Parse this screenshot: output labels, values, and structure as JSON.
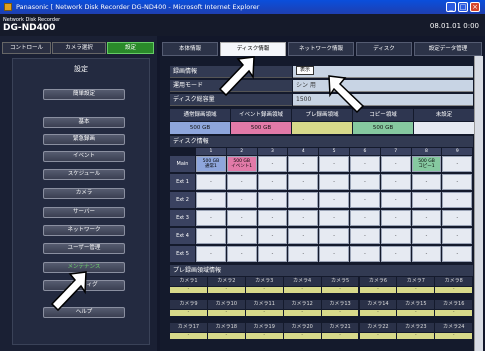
{
  "window": {
    "title": "Panasonic [ Network Disk Recorder DG-ND400 - Microsoft Internet Explorer",
    "minimize": "_",
    "maximize": "□",
    "close": "×"
  },
  "header": {
    "subtitle": "Network Disk Recorder",
    "model": "DG-ND400",
    "clock": "08.01.01 0:00"
  },
  "top_tabs": [
    "コントロール",
    "カメラ選択",
    "設定"
  ],
  "left": {
    "title": "設定",
    "buttons": [
      "簡単設定",
      "基本",
      "緊急録画",
      "イベント",
      "スケジュール",
      "カメラ",
      "サーバー",
      "ネットワーク",
      "ユーザー管理",
      "メンテナンス",
      "コンフィグ",
      "ヘルプ"
    ]
  },
  "right_tabs": [
    "本体情報",
    "ディスク情報",
    "ネットワーク情報",
    "ディスク",
    "設定データ管理"
  ],
  "info": {
    "rows": [
      {
        "label": "録画情報",
        "value": ""
      },
      {
        "label": "運用モード",
        "value": "シン 用"
      },
      {
        "label": "ディスク総容量",
        "value": "1500"
      }
    ],
    "display_button": "表示"
  },
  "capacity": {
    "headers": [
      "通常録画領域",
      "イベント録画領域",
      "プレ録画領域",
      "コピー領域",
      "未設定"
    ],
    "values": [
      "500 GB",
      "500 GB",
      "",
      "500 GB",
      ""
    ]
  },
  "disk_info": {
    "title": "ディスク情報",
    "columns": [
      "1",
      "2",
      "3",
      "4",
      "5",
      "6",
      "7",
      "8",
      "9"
    ],
    "rows": [
      {
        "label": "Main",
        "cells": [
          "500 GB\n通常1",
          "500 GB\nイベント1",
          "-",
          "-",
          "-",
          "-",
          "-",
          "500 GB\nコピー1",
          "-"
        ]
      },
      {
        "label": "Ext 1",
        "cells": [
          "-",
          "-",
          "-",
          "-",
          "-",
          "-",
          "-",
          "-",
          "-"
        ]
      },
      {
        "label": "Ext 2",
        "cells": [
          "-",
          "-",
          "-",
          "-",
          "-",
          "-",
          "-",
          "-",
          "-"
        ]
      },
      {
        "label": "Ext 3",
        "cells": [
          "-",
          "-",
          "-",
          "-",
          "-",
          "-",
          "-",
          "-",
          "-"
        ]
      },
      {
        "label": "Ext 4",
        "cells": [
          "-",
          "-",
          "-",
          "-",
          "-",
          "-",
          "-",
          "-",
          "-"
        ]
      },
      {
        "label": "Ext 5",
        "cells": [
          "-",
          "-",
          "-",
          "-",
          "-",
          "-",
          "-",
          "-",
          "-"
        ]
      }
    ]
  },
  "pre_rec": {
    "title": "プレ録画領域情報",
    "rows": [
      [
        "カメラ1",
        "カメラ2",
        "カメラ3",
        "カメラ4",
        "カメラ5",
        "カメラ6",
        "カメラ7",
        "カメラ8"
      ],
      [
        "カメラ9",
        "カメラ10",
        "カメラ11",
        "カメラ12",
        "カメラ13",
        "カメラ14",
        "カメラ15",
        "カメラ16"
      ],
      [
        "カメラ17",
        "カメラ18",
        "カメラ19",
        "カメラ20",
        "カメラ21",
        "カメラ22",
        "カメラ23",
        "カメラ24"
      ]
    ],
    "value": "-"
  },
  "colors": {
    "normal": "#8ea6dc",
    "event": "#e27aa8",
    "pre": "#d7d98a",
    "copy": "#86c9a0",
    "active_tab": "#2a8a2a"
  }
}
